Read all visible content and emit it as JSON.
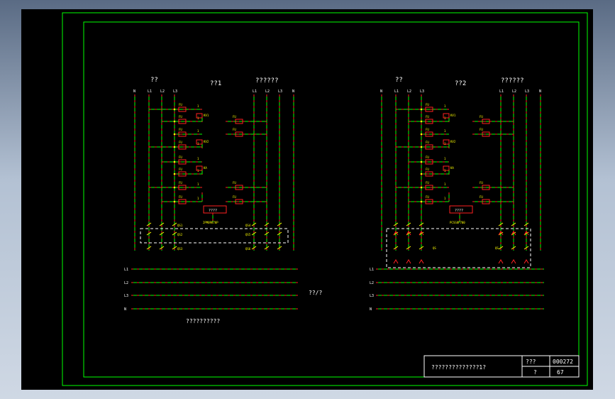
{
  "left_circuit": {
    "label_a": "??",
    "label_b": "??1",
    "label_c": "??????",
    "terminals_left": [
      "N",
      "L1",
      "L2",
      "L3"
    ],
    "terminals_right": [
      "L1",
      "L2",
      "L3",
      "N"
    ],
    "fuses": [
      "FU1",
      "FU2",
      "FU3",
      "FU4",
      "FU5",
      "FU6",
      "FU7"
    ],
    "relays": [
      "KV1",
      "KV2",
      "KA"
    ],
    "meter": "????",
    "meter_model": "2PM09870P",
    "switches": [
      "QS1",
      "QS2",
      "QS3",
      "QS4",
      "QS5",
      "QS6"
    ]
  },
  "right_circuit": {
    "label_a": "??",
    "label_b": "??2",
    "label_c": "??????",
    "terminals_left": [
      "N",
      "L1",
      "L2",
      "L3"
    ],
    "terminals_right": [
      "L1",
      "L2",
      "L3",
      "N"
    ],
    "meter": "????",
    "meter_model": "PCSS8F700",
    "switches": [
      "QS",
      "QS"
    ]
  },
  "bus_labels": [
    "L1",
    "L2",
    "L3",
    "N"
  ],
  "bus_caption": "??/?",
  "left_caption": "??????????",
  "title_block": {
    "name": "??????????????1?",
    "code_label": "???",
    "code": "000272",
    "sheet_label": "?",
    "sheet": "67"
  },
  "colors": {
    "frame": "#00ff00",
    "wire": "#00ff00",
    "dash": "#ff2020",
    "component": "#ffff00",
    "fuse": "#ff2020",
    "text": "#ffffff"
  }
}
